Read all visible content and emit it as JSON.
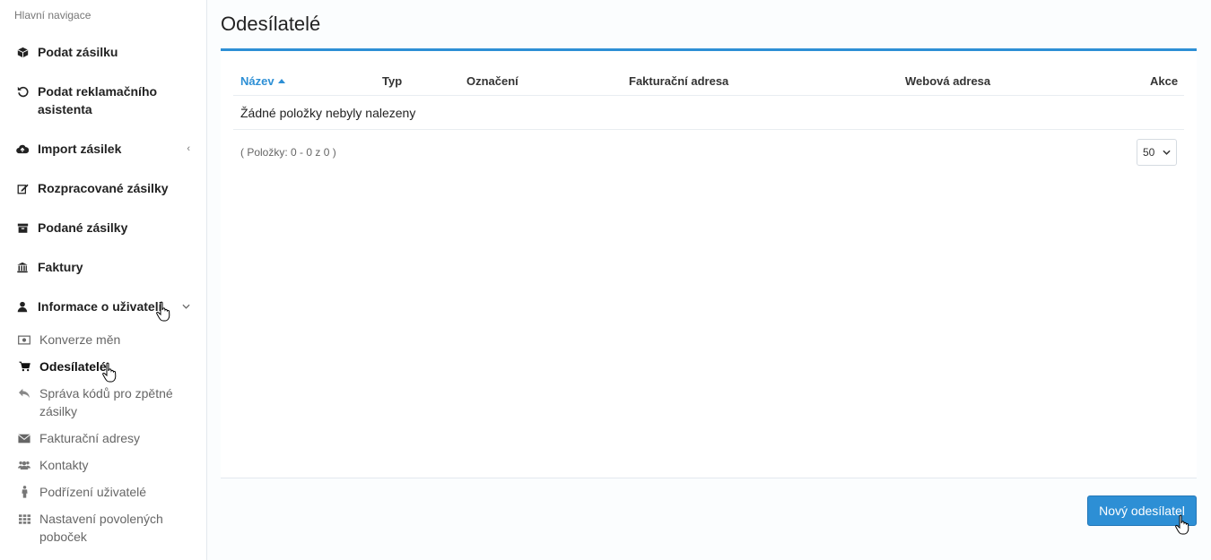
{
  "sidebar": {
    "heading": "Hlavní navigace",
    "items": [
      {
        "label": "Podat zásilku",
        "icon": "box-icon"
      },
      {
        "label": "Podat reklamačního asistenta",
        "icon": "undo-icon"
      },
      {
        "label": "Import zásilek",
        "icon": "cloud-upload-icon"
      },
      {
        "label": "Rozpracované zásilky",
        "icon": "edit-icon"
      },
      {
        "label": "Podané zásilky",
        "icon": "archive-icon"
      },
      {
        "label": "Faktury",
        "icon": "bank-icon"
      },
      {
        "label": "Informace o uživateli",
        "icon": "user-icon"
      }
    ],
    "subitems": [
      {
        "label": "Konverze měn",
        "icon": "money-icon"
      },
      {
        "label": "Odesílatelé",
        "icon": "cart-icon",
        "active": true
      },
      {
        "label": "Správa kódů pro zpětné zásilky",
        "icon": "reply-icon"
      },
      {
        "label": "Fakturační adresy",
        "icon": "envelope-icon"
      },
      {
        "label": "Kontakty",
        "icon": "users-icon"
      },
      {
        "label": "Podřízení uživatelé",
        "icon": "person-icon"
      },
      {
        "label": "Nastavení povolených poboček",
        "icon": "grid-icon"
      }
    ]
  },
  "page": {
    "title": "Odesílatelé"
  },
  "table": {
    "columns": [
      "Název",
      "Typ",
      "Označení",
      "Fakturační adresa",
      "Webová adresa",
      "Akce"
    ],
    "empty_text": "Žádné položky nebyly nalezeny",
    "pager_info": "( Položky: 0 - 0 z 0 )",
    "page_size": "50"
  },
  "actions": {
    "new_sender": "Nový odesílatel"
  },
  "colors": {
    "accent": "#2d8fd5"
  }
}
